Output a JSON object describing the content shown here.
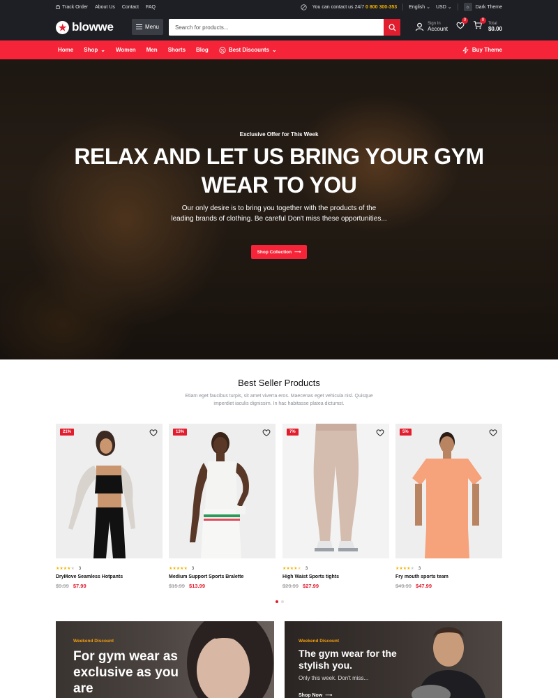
{
  "topbar": {
    "links": [
      "Track Order",
      "About Us",
      "Contact",
      "FAQ"
    ],
    "contact_text": "You can contact us 24/7",
    "phone": "0 800 300-353",
    "language": "English",
    "currency": "USD",
    "theme_label": "Dark Theme"
  },
  "header": {
    "logo": "blowwe",
    "menu_label": "Menu",
    "search_placeholder": "Search for products...",
    "account_small": "Sign In",
    "account_big": "Account",
    "wishlist_count": "0",
    "cart_count": "0",
    "total_small": "Total",
    "total_big": "$0.00"
  },
  "nav": {
    "items": [
      "Home",
      "Shop",
      "Women",
      "Men",
      "Shorts",
      "Blog",
      "Best Discounts"
    ],
    "buy_label": "Buy Theme"
  },
  "hero": {
    "kicker": "Exclusive Offer for This Week",
    "title": "RELAX AND LET US BRING YOUR GYM WEAR TO YOU",
    "text": "Our only desire is to bring you together with the products of the leading brands of clothing. Be careful Don't miss these opportunities...",
    "cta": "Shop Collection"
  },
  "bestseller": {
    "title": "Best Seller Products",
    "subtitle": "Etiam eget faucibus turpis, sit amet viverra eros. Maecenas eget vehicula nisl. Quisque imperdiet iaculis dignissim. In hac habitasse platea dictumst.",
    "products": [
      {
        "badge": "21%",
        "rating": 4,
        "reviews": "3",
        "name": "DryMove Seamless Hotpants",
        "old_price": "$9.99",
        "price": "$7.99"
      },
      {
        "badge": "13%",
        "rating": 5,
        "reviews": "3",
        "name": "Medium Support Sports Bralette",
        "old_price": "$15.99",
        "price": "$13.99"
      },
      {
        "badge": "7%",
        "rating": 4.5,
        "reviews": "3",
        "name": "High Waist Sports tights",
        "old_price": "$29.99",
        "price": "$27.99"
      },
      {
        "badge": "5%",
        "rating": 4,
        "reviews": "3",
        "name": "Fry mouth sports team",
        "old_price": "$49.99",
        "price": "$47.99"
      }
    ]
  },
  "promos": [
    {
      "kicker": "Weekend Discount",
      "headline": "For gym wear as exclusive as you are"
    },
    {
      "kicker": "Weekend Discount",
      "headline": "The gym wear for the stylish you.",
      "sub": "Only this week. Don't miss...",
      "cta": "Shop Now"
    }
  ],
  "colors": {
    "accent": "#f52438",
    "dark": "#1d1f24",
    "rating": "#f5b400"
  }
}
